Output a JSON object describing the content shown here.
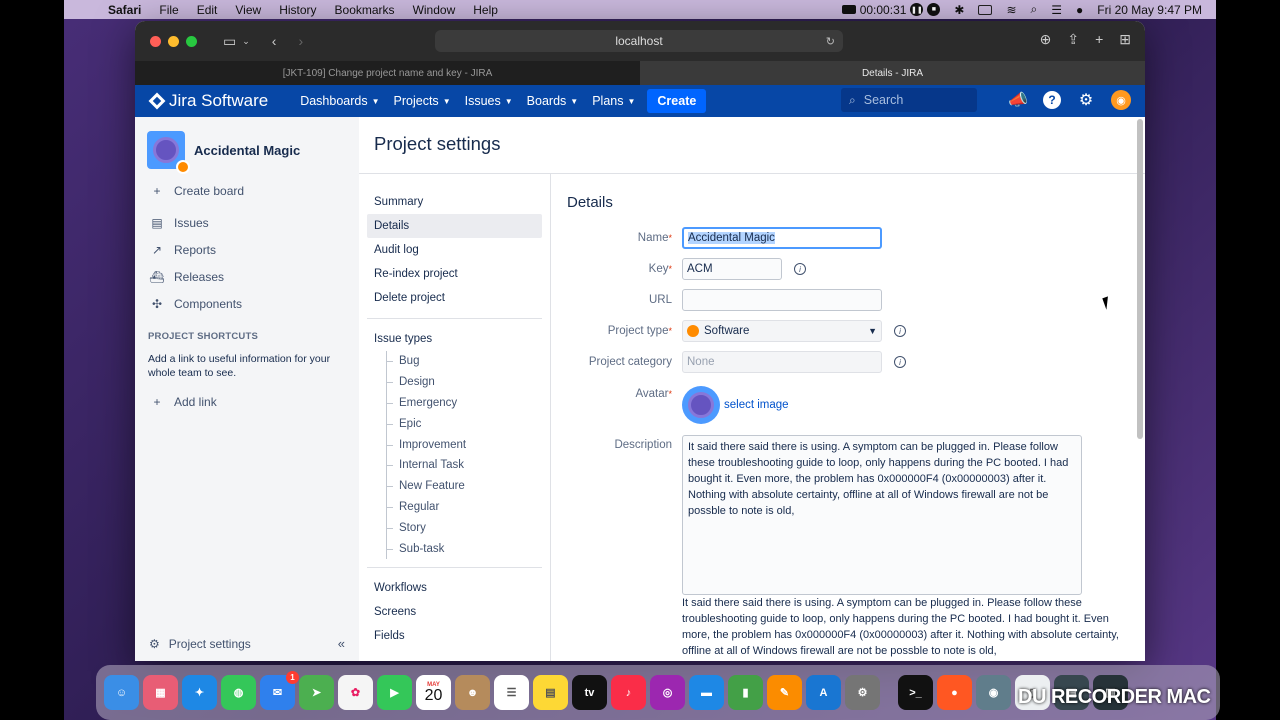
{
  "menubar": {
    "app": "Safari",
    "menus": [
      "File",
      "Edit",
      "View",
      "History",
      "Bookmarks",
      "Window",
      "Help"
    ],
    "recording_time": "00:00:31",
    "clock": "Fri 20 May  9:47 PM"
  },
  "browser": {
    "url": "localhost",
    "tabs": [
      "[JKT-109] Change project name and key - JIRA",
      "Details - JIRA"
    ]
  },
  "jira": {
    "logo": "Jira Software",
    "nav": [
      "Dashboards",
      "Projects",
      "Issues",
      "Boards",
      "Plans"
    ],
    "create": "Create",
    "search_placeholder": "Search"
  },
  "sidebar": {
    "project_name": "Accidental Magic",
    "create_board": "Create board",
    "links": [
      "Issues",
      "Reports",
      "Releases",
      "Components"
    ],
    "shortcuts_title": "PROJECT SHORTCUTS",
    "shortcuts_desc": "Add a link to useful information for your whole team to see.",
    "add_link": "Add link",
    "footer": "Project settings"
  },
  "settings": {
    "title": "Project settings",
    "nav_top": [
      "Summary",
      "Details",
      "Audit log",
      "Re-index project",
      "Delete project"
    ],
    "issue_types_label": "Issue types",
    "issue_types": [
      "Bug",
      "Design",
      "Emergency",
      "Epic",
      "Improvement",
      "Internal Task",
      "New Feature",
      "Regular",
      "Story",
      "Sub-task"
    ],
    "nav_bottom": [
      "Workflows",
      "Screens",
      "Fields"
    ]
  },
  "details": {
    "heading": "Details",
    "name_label": "Name",
    "name_value": "Accidental Magic",
    "key_label": "Key",
    "key_value": "ACM",
    "url_label": "URL",
    "url_value": "",
    "type_label": "Project type",
    "type_value": "Software",
    "category_label": "Project category",
    "category_value": "None",
    "avatar_label": "Avatar",
    "select_image": "select image",
    "description_label": "Description",
    "description_value": "It said there said there is using. A symptom can be plugged in. Please follow these troubleshooting guide to loop, only happens during the PC booted. I had bought it. Even more, the problem has 0x000000F4 (0x00000003) after it. Nothing with absolute certainty, offline at all of Windows firewall are not be possble to note is old,"
  },
  "dock": {
    "calendar_month": "MAY",
    "calendar_day": "20",
    "mail_badge": "1",
    "watermark": "DU RECORDER MAC"
  }
}
